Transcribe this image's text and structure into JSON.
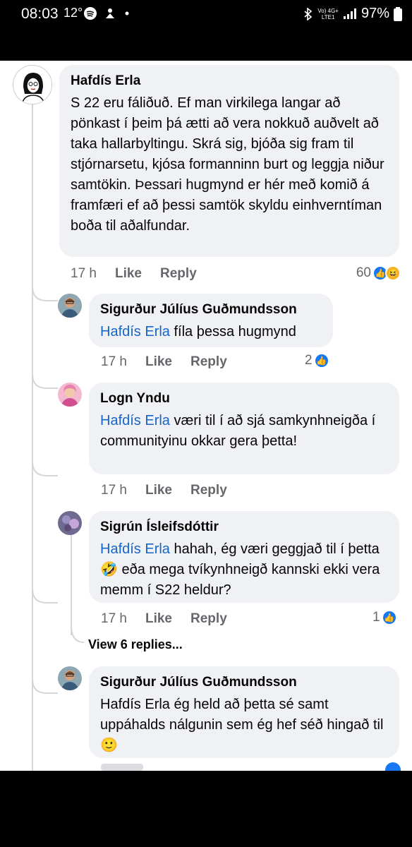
{
  "status_bar": {
    "time": "08:03",
    "temperature": "12°",
    "network_top": "Vo) 4G+",
    "network_bottom": "LTE1",
    "battery": "97%"
  },
  "comments": [
    {
      "author": "Hafdís Erla",
      "text": "S 22 eru fáliðuð. Ef man virkilega langar að pönkast í þeim þá ætti að vera nokkuð auðvelt að taka hallarbyltingu. Skrá sig, bjóða sig fram til stjórnarsetu, kjósa formanninn burt og leggja niður samtökin. Þessari hugmynd er hér með komið á framfæri ef að þessi samtök skyldu einhverntíman boða til aðalfundar.",
      "time": "17 h",
      "like": "Like",
      "reply": "Reply",
      "reactions": "60"
    },
    {
      "author": "Sigurður Júlíus Guðmundsson",
      "mention": "Hafdís Erla",
      "text": " fíla þessa hugmynd",
      "time": "17 h",
      "like": "Like",
      "reply": "Reply",
      "reactions": "2"
    },
    {
      "author": "Logn Yndu",
      "mention": "Hafdís Erla",
      "text": " væri til í að sjá samkynhneigða í communityinu okkar gera þetta!",
      "time": "17 h",
      "like": "Like",
      "reply": "Reply"
    },
    {
      "author": "Sigrún Ísleifsdóttir",
      "mention": "Hafdís Erla",
      "text_a": " hahah, ég væri geggjað til í þetta ",
      "emoji": "🤣",
      "text_b": " eða mega tvíkynhneigð kannski ekki vera memm í S22 heldur?",
      "time": "17 h",
      "like": "Like",
      "reply": "Reply",
      "reactions": "1"
    },
    {
      "author": "Sigurður Júlíus Guðmundsson",
      "text": "Hafdís Erla ég held að þetta sé samt uppáhalds nálgunin sem ég hef séð hingað til ",
      "emoji": "🙂"
    }
  ],
  "view_replies": "View 6 replies..."
}
